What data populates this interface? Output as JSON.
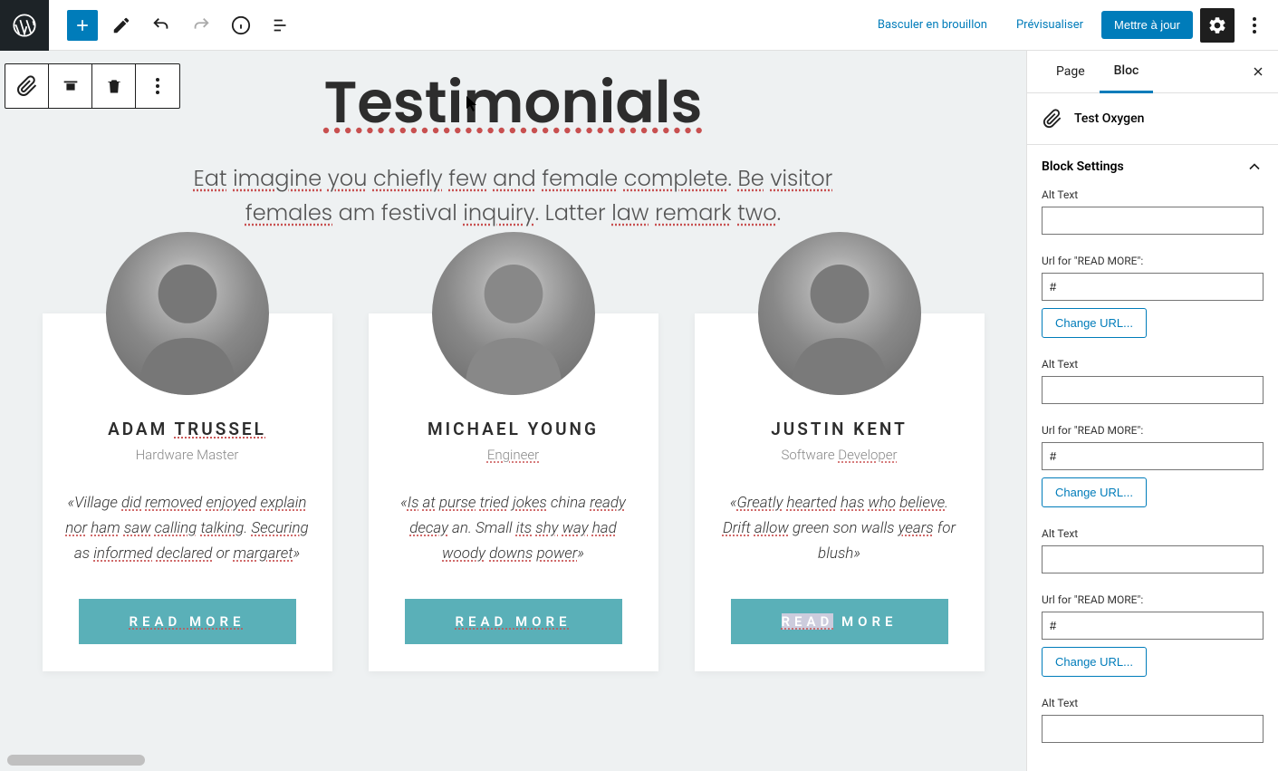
{
  "toolbar": {
    "switch_draft": "Basculer en brouillon",
    "preview": "Prévisualiser",
    "update": "Mettre à jour"
  },
  "sidebar": {
    "tab_page": "Page",
    "tab_bloc": "Bloc",
    "block_name": "Test Oxygen",
    "panel_title": "Block Settings",
    "fields": [
      {
        "alt_label": "Alt Text",
        "alt_value": "",
        "url_label": "Url for \"READ MORE\":",
        "url_value": "#",
        "change_url": "Change URL..."
      },
      {
        "alt_label": "Alt Text",
        "alt_value": "",
        "url_label": "Url for \"READ MORE\":",
        "url_value": "#",
        "change_url": "Change URL..."
      },
      {
        "alt_label": "Alt Text",
        "alt_value": "",
        "url_label": "Url for \"READ MORE\":",
        "url_value": "#",
        "change_url": "Change URL..."
      },
      {
        "alt_label": "Alt Text",
        "alt_value": ""
      }
    ]
  },
  "content": {
    "title": "Testimonials",
    "subtitle_parts": {
      "p1": "Eat",
      "p2": "imagine",
      "p3": "you",
      "p4": "chiefly",
      "p5": "few",
      "p6": "and",
      "p7": "female",
      "p8": "complete",
      "p9": ". ",
      "p10": "Be",
      "p11": "visitor",
      "p12": "females",
      "p13": " am festival ",
      "p14": "inquiry",
      "p15": ". Latter ",
      "p16": "law",
      "p17": "remark",
      "p18": "two",
      "p19": "."
    },
    "testimonials": [
      {
        "name_pre": "ADAM ",
        "name_ul": "TRUSSEL",
        "role_pre": "Hardware Master",
        "role_ul": "",
        "quote_html": "«Village <span class='ul'>did</span> <span class='ul'>removed</span> <span class='ul'>enjoyed</span> <span class='ul'>explain</span> <span class='ul'>nor</span> <span class='ul'>ham</span> <span class='ul'>saw</span> <span class='ul'>calling</span> <span class='ul'>talking</span>. <span class='ul'>Securing</span> as <span class='ul'>informed</span> <span class='ul'>declared</span> or <span class='ul'>margaret</span>»",
        "read_more": "READ MORE"
      },
      {
        "name_pre": "MICHAEL YOUNG",
        "name_ul": "",
        "role_pre": "",
        "role_ul": "Engineer",
        "quote_html": "«<span class='ul'>Is</span> <span class='ul'>at</span> <span class='ul'>purse</span> <span class='ul'>tried</span> <span class='ul'>jokes</span> china <span class='ul'>ready</span> <span class='ul'>decay</span> an. Small <span class='ul'>its</span> <span class='ul'>shy</span> <span class='ul'>way</span> <span class='ul'>had</span> <span class='ul'>woody</span> <span class='ul'>downs</span> <span class='ul'>power</span>»",
        "read_more": "READ MORE"
      },
      {
        "name_pre": "JUSTIN KENT",
        "name_ul": "",
        "role_pre": "Software ",
        "role_ul": "Developer",
        "quote_html": "«<span class='ul'>Greatly</span> <span class='ul'>hearted</span> <span class='ul'>has</span> <span class='ul'>who</span> <span class='ul'>believe</span>. <span class='ul'>Drift</span> <span class='ul'>allow</span> green son walls <span class='ul'>years</span> for blush»",
        "read_more_pre": "READ",
        "read_more_post": " MORE"
      }
    ]
  }
}
